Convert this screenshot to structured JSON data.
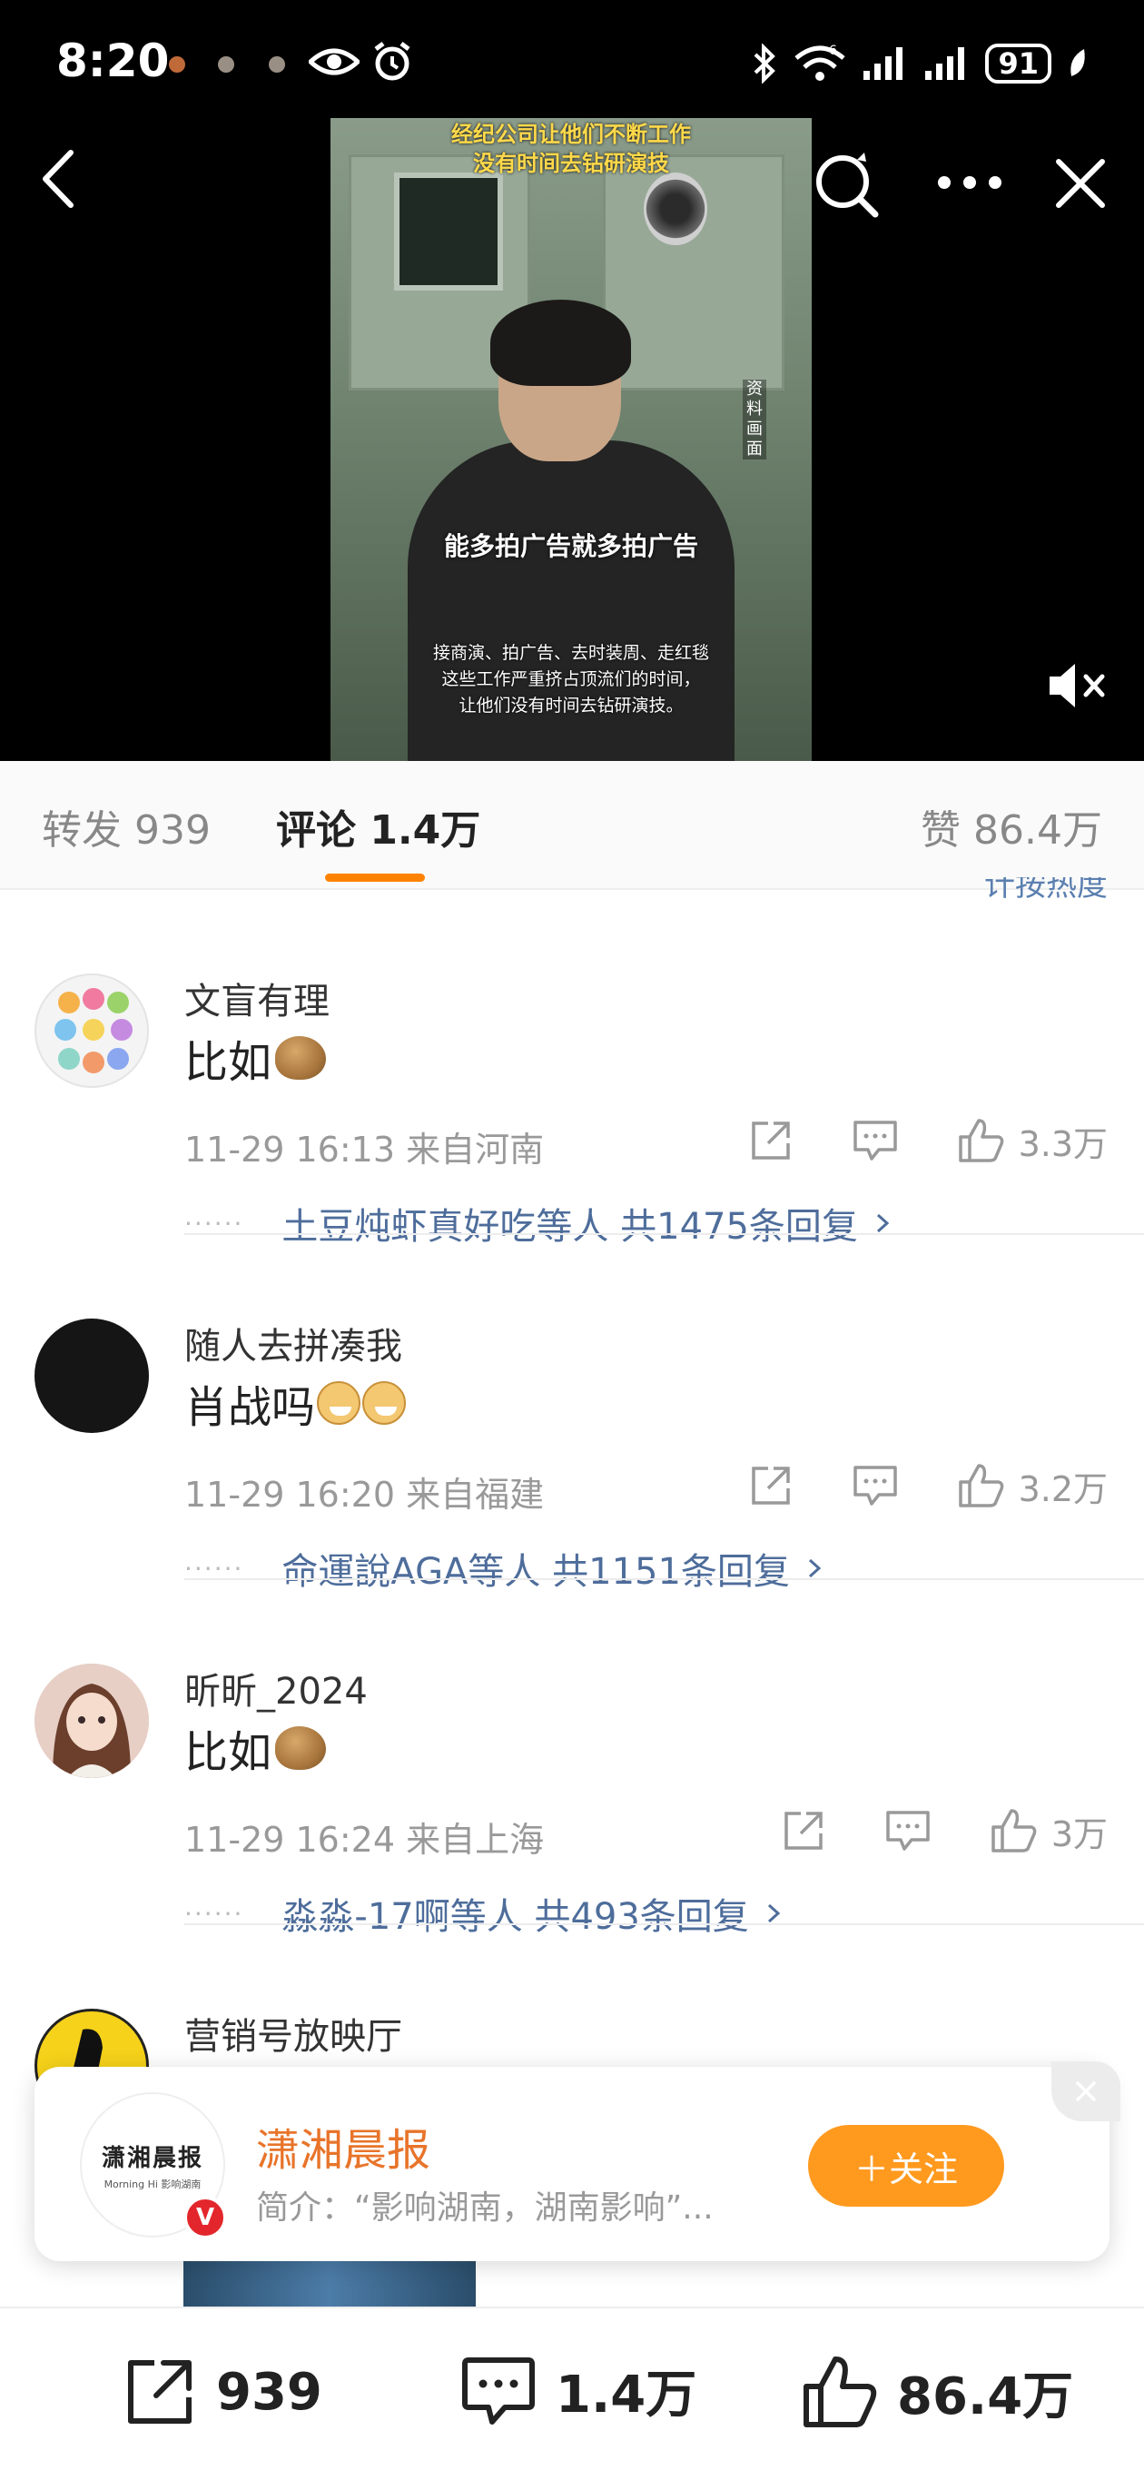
{
  "status_bar": {
    "time": "8:20",
    "network": "6",
    "battery": "91"
  },
  "video": {
    "caption_top": [
      "经纪公司让他们不断工作",
      "没有时间去钻研演技"
    ],
    "side_label": [
      "资",
      "料",
      "画",
      "面"
    ],
    "caption_mid": "能多拍广告就多拍广告",
    "caption_bottom": [
      "接商演、拍广告、去时装周、走红毯",
      "这些工作严重挤占顶流们的时间，",
      "让他们没有时间去钻研演技。"
    ]
  },
  "tabs": {
    "repost": "转发 939",
    "comment": "评论 1.4万",
    "like": "赞 86.4万",
    "sort_peek": "计按热度"
  },
  "comments": [
    {
      "name": "文盲有理",
      "text": "比如",
      "emoji": "potato-emoji",
      "meta": "11-29 16:13  来自河南",
      "likes": "3.3万",
      "replies": "土豆炖虾真好吃等人  共1475条回复",
      "avatar_color": "#f2f2f2"
    },
    {
      "name": "随人去拼凑我",
      "text": "肖战吗",
      "emoji": "doge-emoji",
      "meta": "11-29 16:20  来自福建",
      "likes": "3.2万",
      "replies": "命運說AGA等人  共1151条回复",
      "avatar_color": "#151515"
    },
    {
      "name": "昕昕_2024",
      "text": "比如",
      "emoji": "potato-emoji",
      "meta": "11-29 16:24  来自上海",
      "likes": "3万",
      "replies": "淼淼-17啊等人  共493条回复",
      "avatar_color": "#c8a49a"
    },
    {
      "name": "营销号放映厅",
      "avatar_color": "#f6d21a"
    }
  ],
  "follow_card": {
    "logo_text": "潇湘晨报",
    "logo_sub": "Morning Hi 影响湖南",
    "verified_badge": "V",
    "name": "潇湘晨报",
    "desc": "简介：“影响湖南，湖南影响”...",
    "follow_button": "＋关注"
  },
  "bottom_bar": {
    "repost": "939",
    "comment": "1.4万",
    "like": "86.4万"
  },
  "colors": {
    "accent": "#ff8200",
    "link": "#4e6d9b",
    "follow_button": "#ff9a1f",
    "brand_name": "#e8742a"
  }
}
